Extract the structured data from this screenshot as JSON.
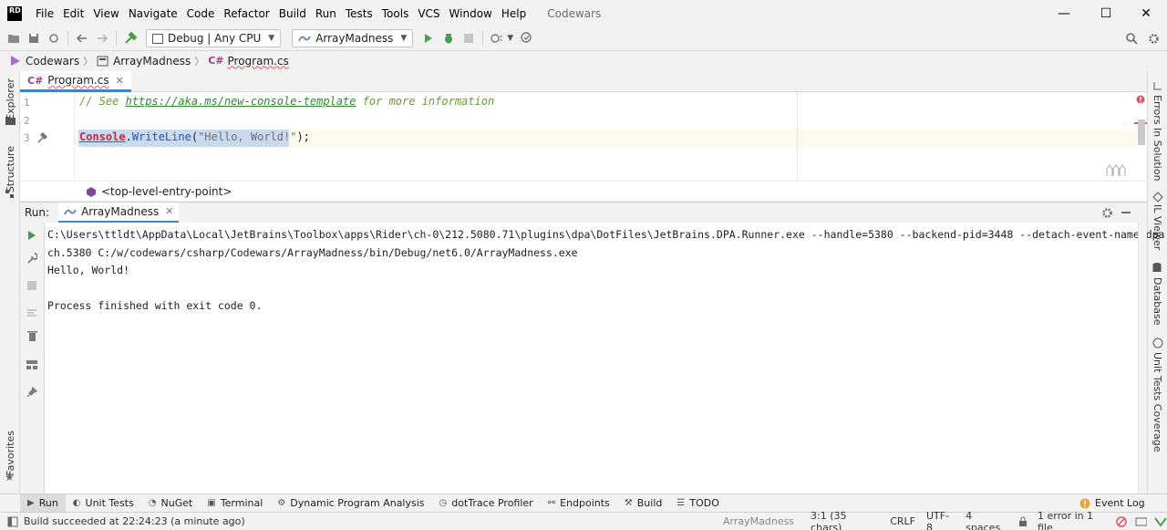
{
  "app": {
    "logo_text": "RD",
    "project_title": "Codewars"
  },
  "menu": [
    "File",
    "Edit",
    "View",
    "Navigate",
    "Code",
    "Refactor",
    "Build",
    "Run",
    "Tests",
    "Tools",
    "VCS",
    "Window",
    "Help"
  ],
  "window_controls": {
    "minimize": "—",
    "maximize": "☐",
    "close": "✕"
  },
  "toolbar": {
    "config": "Debug | Any CPU",
    "run_target": "ArrayMadness"
  },
  "breadcrumbs": [
    "Codewars",
    "ArrayMadness",
    "Program.cs"
  ],
  "editor_tab": {
    "lang": "C#",
    "name": "Program.cs"
  },
  "editor": {
    "line_numbers": [
      "1",
      "2",
      "3"
    ],
    "line1_comment_pre": "// See ",
    "line1_link": "https://aka.ms/new-console-template",
    "line1_comment_post": " for more information",
    "line3_class": "Console",
    "line3_dot": ".",
    "line3_method": "WriteLine",
    "line3_open": "(",
    "line3_string": "\"Hello, World!\"",
    "line3_close": ");"
  },
  "code_breadcrumb": "<top-level-entry-point>",
  "run_panel": {
    "label": "Run:",
    "tab": "ArrayMadness",
    "console": [
      "C:\\Users\\ttldt\\AppData\\Local\\JetBrains\\Toolbox\\apps\\Rider\\ch-0\\212.5080.71\\plugins\\dpa\\DotFiles\\JetBrains.DPA.Runner.exe --handle=5380 --backend-pid=3448 --detach-event-name=dpa.deta",
      "ch.5380 C:/w/codewars/csharp/Codewars/ArrayMadness/bin/Debug/net6.0/ArrayMadness.exe",
      "Hello, World!",
      "",
      "Process finished with exit code 0."
    ]
  },
  "left_tools": {
    "explorer": "Explorer",
    "structure": "Structure",
    "favorites": "Favorites"
  },
  "right_tools": {
    "errors": "Errors In Solution",
    "il": "IL Viewer",
    "database": "Database",
    "coverage": "Unit Tests Coverage"
  },
  "bottom_tabs": [
    "Run",
    "Unit Tests",
    "NuGet",
    "Terminal",
    "Dynamic Program Analysis",
    "dotTrace Profiler",
    "Endpoints",
    "Build",
    "TODO"
  ],
  "event_log": "Event Log",
  "status": {
    "message": "Build succeeded at 22:24:23 (a minute ago)",
    "project": "ArrayMadness",
    "position": "3:1 (35 chars)",
    "line_sep": "CRLF",
    "encoding": "UTF-8",
    "indent": "4 spaces",
    "errors": "1 error in 1 file"
  },
  "colors": {
    "accent": "#4083c9",
    "run_green": "#499c54",
    "error_red": "#db5860",
    "comment": "#6a9a3a"
  }
}
